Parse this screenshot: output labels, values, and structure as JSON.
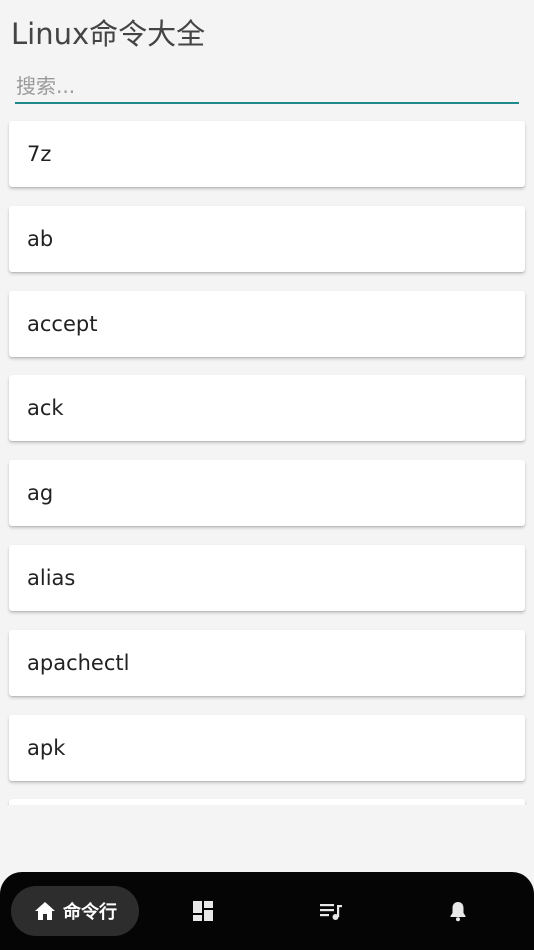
{
  "app": {
    "title": "Linux命令大全"
  },
  "search": {
    "placeholder": "搜索...",
    "value": ""
  },
  "commands": [
    "7z",
    "ab",
    "accept",
    "ack",
    "ag",
    "alias",
    "apachectl",
    "apk",
    ""
  ],
  "bottom_nav": {
    "items": [
      {
        "label": "命令行",
        "icon": "home-icon",
        "active": true
      },
      {
        "label": "",
        "icon": "dashboard-icon",
        "active": false
      },
      {
        "label": "",
        "icon": "playlist-music-icon",
        "active": false
      },
      {
        "label": "",
        "icon": "bell-icon",
        "active": false
      }
    ]
  },
  "colors": {
    "accent": "#1f8a8a",
    "background": "#f4f4f4",
    "nav_background": "#050505",
    "nav_active_pill": "#2d2d2d"
  }
}
